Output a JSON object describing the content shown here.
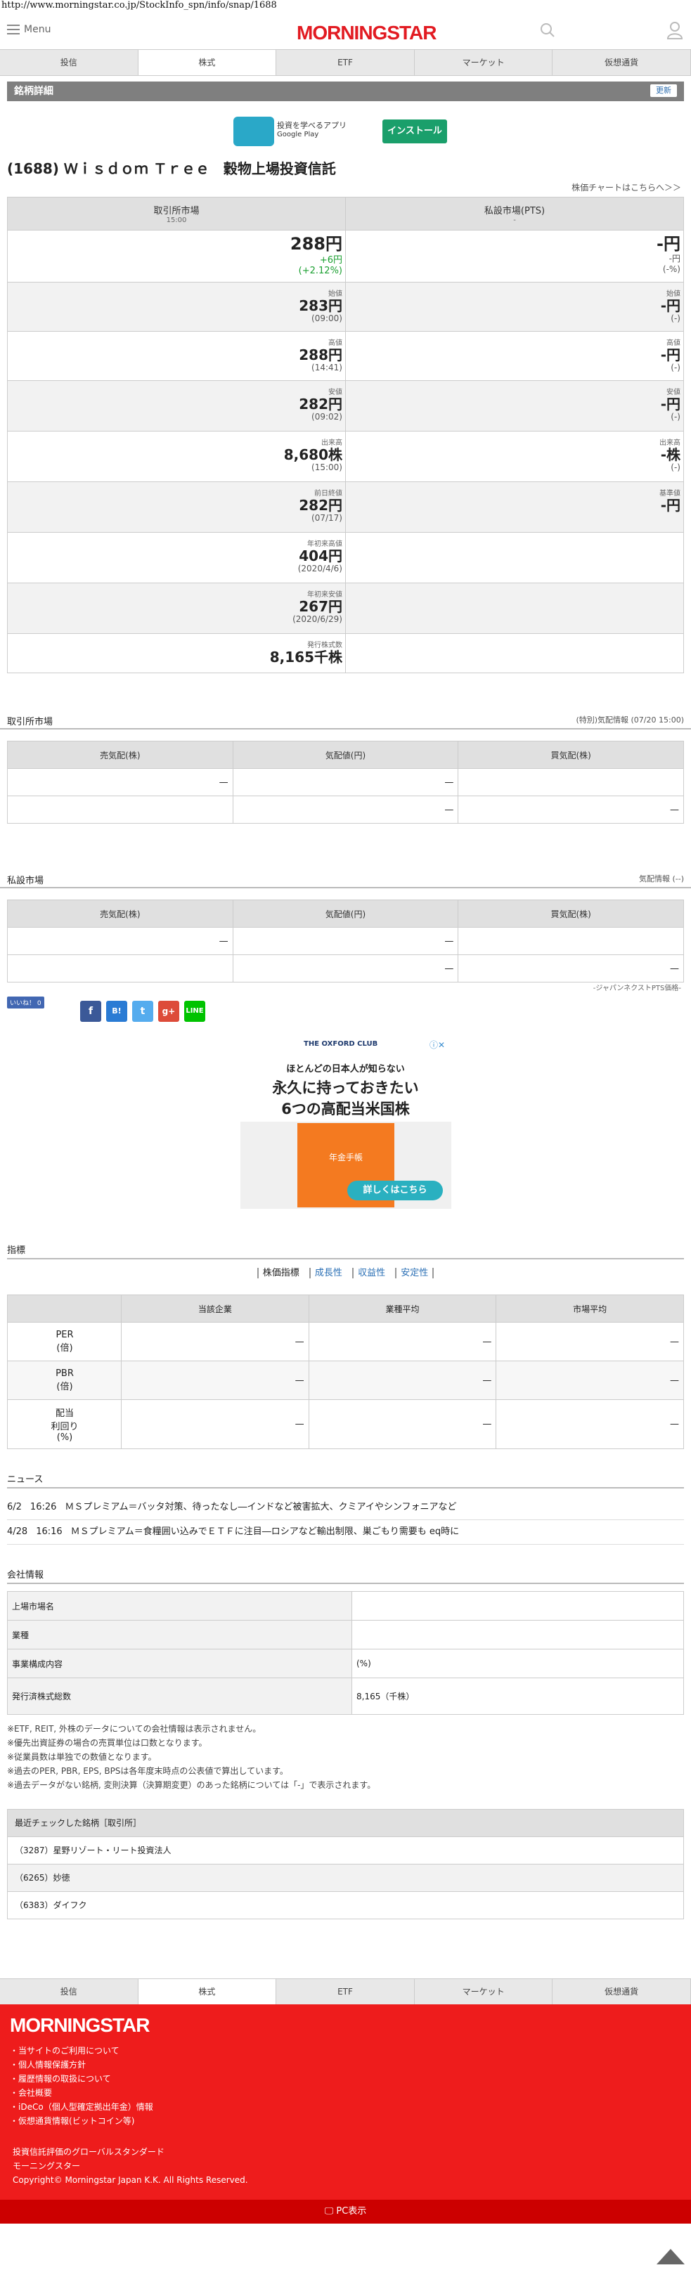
{
  "url": "http://www.morningstar.co.jp/StockInfo_spn/info/snap/1688",
  "header": {
    "menu_label": "Menu",
    "logo_text": "MORNINGSTAR"
  },
  "tabs": [
    "投信",
    "株式",
    "ETF",
    "マーケット",
    "仮想通貨"
  ],
  "active_tab": "株式",
  "section_title": "銘柄詳細",
  "update_button": "更新",
  "app_ad": {
    "text": "投資を学べるアプリ",
    "store": "Google Play",
    "install": "インストール"
  },
  "stock_title": "(1688) Ｗｉｓｄｏｍ Ｔｒｅｅ　穀物上場投資信託",
  "chart_link": "株価チャートはこちらへ＞＞",
  "quote": {
    "left_header": "取引所市場",
    "left_time": "15:00",
    "right_header": "私設市場(PTS)",
    "right_time": "-",
    "price": "288円",
    "change": "+6円",
    "change_pct": "(+2.12%)",
    "pts_price": "-円",
    "pts_change": "-円",
    "pts_change_pct": "(-%)",
    "rows": [
      {
        "label": "始値",
        "value": "283円",
        "sub": "(09:00)",
        "pts_label": "始値",
        "pts_value": "-円",
        "pts_sub": "(-)"
      },
      {
        "label": "高値",
        "value": "288円",
        "sub": "(14:41)",
        "pts_label": "高値",
        "pts_value": "-円",
        "pts_sub": "(-)"
      },
      {
        "label": "安値",
        "value": "282円",
        "sub": "(09:02)",
        "pts_label": "安値",
        "pts_value": "-円",
        "pts_sub": "(-)"
      },
      {
        "label": "出来高",
        "value": "8,680株",
        "sub": "(15:00)",
        "pts_label": "出来高",
        "pts_value": "-株",
        "pts_sub": "(-)"
      },
      {
        "label": "前日終値",
        "value": "282円",
        "sub": "(07/17)",
        "pts_label": "基準値",
        "pts_value": "-円",
        "pts_sub": ""
      },
      {
        "label": "年初来高値",
        "value": "404円",
        "sub": "(2020/4/6)"
      },
      {
        "label": "年初来安値",
        "value": "267円",
        "sub": "(2020/6/29)"
      },
      {
        "label": "発行株式数",
        "value": "8,165千株",
        "sub": ""
      }
    ]
  },
  "exchange_market": {
    "title": "取引所市場",
    "note": "(特別)気配情報 (07/20 15:00)",
    "headers": [
      "売気配(株)",
      "気配値(円)",
      "買気配(株)"
    ],
    "rows": [
      [
        "",
        "—",
        "—"
      ],
      [
        "",
        "—",
        "—"
      ]
    ]
  },
  "pts_market": {
    "title": "私設市場",
    "note": "気配情報 (--)",
    "headers": [
      "売気配(株)",
      "気配値(円)",
      "買気配(株)"
    ],
    "rows": [
      [
        "",
        "—",
        "—"
      ],
      [
        "",
        "—",
        "—"
      ]
    ],
    "footnote": "-ジャパンネクストPTS価格-"
  },
  "social": {
    "like": "いいね！ 0"
  },
  "ad": {
    "brand": "THE OXFORD CLUB",
    "line1": "ほとんどの日本人が知らない",
    "line2": "永久に持っておきたい",
    "line3": "6つの高配当米国株",
    "book": "年金手帳",
    "cta": "詳しくはこちら"
  },
  "indicators": {
    "title": "指標",
    "subnav": [
      "株価指標",
      "成長性",
      "収益性",
      "安定性"
    ],
    "headers": [
      "",
      "当該企業",
      "業種平均",
      "市場平均"
    ],
    "rows": [
      {
        "name": "PER\n(倍)",
        "values": [
          "—",
          "—",
          "—"
        ]
      },
      {
        "name": "PBR\n(倍)",
        "values": [
          "—",
          "—",
          "—"
        ]
      },
      {
        "name": "配当\n利回り\n(%)",
        "values": [
          "—",
          "—",
          "—"
        ]
      }
    ]
  },
  "news": {
    "title": "ニュース",
    "items": [
      {
        "date": "6/2",
        "time": "16:26",
        "text": "ＭＳプレミアム＝バッタ対策、待ったなし―インドなど被害拡大、クミアイやシンフォニアなど"
      },
      {
        "date": "4/28",
        "time": "16:16",
        "text": "ＭＳプレミアム＝食糧囲い込みでＥＴＦに注目―ロシアなど輸出制限、巣ごもり需要も eq時に"
      }
    ]
  },
  "company": {
    "title": "会社情報",
    "rows": [
      [
        "上場市場名",
        ""
      ],
      [
        "業種",
        ""
      ],
      [
        "事業構成内容",
        "(%)"
      ],
      [
        "発行済株式総数",
        "8,165（千株）"
      ]
    ],
    "notes": [
      "※ETF, REIT, 外株のデータについての会社情報は表示されません。",
      "※優先出資証券の場合の売買単位は口数となります。",
      "※従業員数は単独での数値となります。",
      "※過去のPER, PBR, EPS, BPSは各年度末時点の公表値で算出しています。",
      "※過去データがない銘柄, 変則決算（決算期変更）のあった銘柄については「-」で表示されます。"
    ]
  },
  "recent": {
    "title": "最近チェックした銘柄［取引所］",
    "items": [
      "（3287）星野リゾート・リート投資法人",
      "（6265）妙徳",
      "（6383）ダイフク"
    ]
  },
  "footer": {
    "logo": "MORNINGSTAR",
    "links": [
      "当サイトのご利用について",
      "個人情報保護方針",
      "履歴情報の取扱について",
      "会社概要",
      "iDeCo（個人型確定拠出年金）情報",
      "仮想通貨情報(ビットコイン等)"
    ],
    "tagline": "投資信託評価のグローバルスタンダード",
    "name": "モーニングスター",
    "copyright": "Copyright© Morningstar Japan K.K. All Rights Reserved.",
    "pc": "PC表示"
  }
}
